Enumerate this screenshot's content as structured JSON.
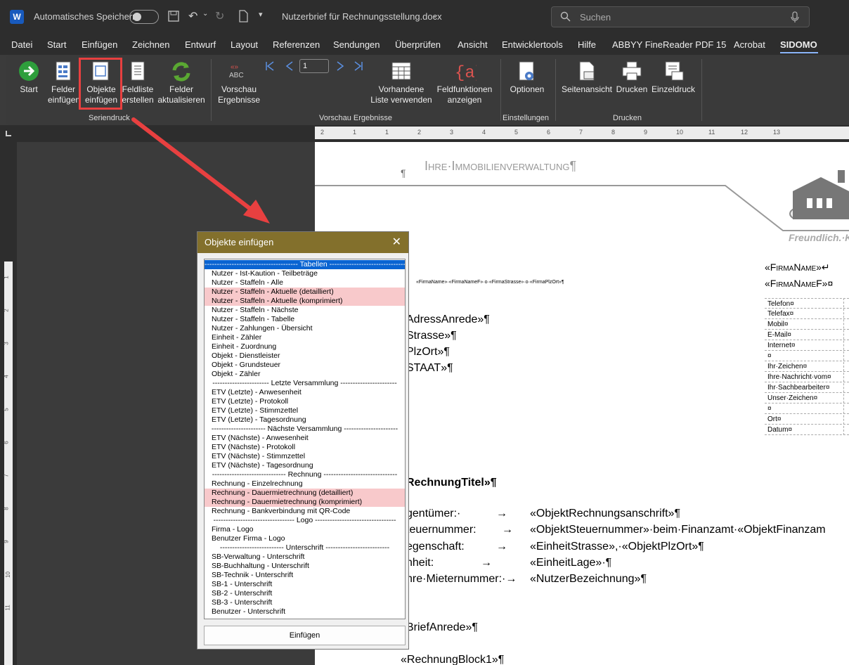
{
  "titlebar": {
    "app_logo": "W",
    "autosave_label": "Automatisches Speichern",
    "doc_title": "Nutzerbrief für Rechnungsstellung.docx",
    "search_placeholder": "Suchen"
  },
  "menu": [
    "Datei",
    "Start",
    "Einfügen",
    "Zeichnen",
    "Entwurf",
    "Layout",
    "Referenzen",
    "Sendungen",
    "Überprüfen",
    "Ansicht",
    "Entwicklertools",
    "Hilfe",
    "ABBYY FineReader PDF 15",
    "Acrobat",
    "SIDOMO"
  ],
  "ribbon": {
    "start": "Start",
    "felder_einfuegen_1": "Felder",
    "felder_einfuegen_2": "einfügen",
    "objekte_einfuegen_1": "Objekte",
    "objekte_einfuegen_2": "einfügen",
    "feldliste_1": "Feldliste",
    "feldliste_2": "erstellen",
    "felder_aktualisieren_1": "Felder",
    "felder_aktualisieren_2": "aktualisieren",
    "group_seriendruck": "Seriendruck",
    "vorschau_1": "Vorschau",
    "vorschau_2": "Ergebnisse",
    "record_number": "1",
    "vorhandene_1": "Vorhandene",
    "vorhandene_2": "Liste verwenden",
    "feldfunktionen_1": "Feldfunktionen",
    "feldfunktionen_2": "anzeigen",
    "group_vorschau": "Vorschau Ergebnisse",
    "optionen": "Optionen",
    "group_einstellungen": "Einstellungen",
    "seitenansicht": "Seitenansicht",
    "drucken": "Drucken",
    "einzeldruck": "Einzeldruck",
    "group_drucken": "Drucken"
  },
  "document": {
    "header_title": "Ihre·Immobilienverwaltung¶",
    "pilcrow": "¶",
    "slogan": "Freundlich.·K",
    "sender_line": "«FirmaName»·«FirmaNameF»·o·«FirmaStrasse»·o·«FirmaPlzOrt»¶",
    "firma_name": "«FirmaName»↵",
    "firma_name_f": "«FirmaNameF»¤",
    "address": [
      "AdressAnrede»¶",
      "Strasse»¶",
      "PlzOrt»¶",
      "STAAT»¶"
    ],
    "info_rows": [
      "Telefon¤",
      "Telefax¤",
      "Mobil¤",
      "E-Mail¤",
      "Internet¤",
      "¤",
      "Ihr·Zeichen¤",
      "Ihre·Nachricht·vom¤",
      "Ihr·Sachbearbeiter¤",
      "Unser·Zeichen¤",
      "¤",
      "Ort¤",
      "Datum¤"
    ],
    "rechnung_titel": "RechnungTitel»¶",
    "fields": [
      {
        "label": "gentümer:·",
        "arrow": "→",
        "value": "«ObjektRechnungsanschrift»¶"
      },
      {
        "label": "teuernummer:",
        "arrow": "→",
        "value": "«ObjektSteuernummer»·beim·Finanzamt·«ObjektFinanzam"
      },
      {
        "label": "egenschaft:",
        "arrow": "→",
        "value": "«EinheitStrasse»,·«ObjektPlzOrt»¶"
      },
      {
        "label": "nheit:",
        "arrow": "→",
        "value": "«EinheitLage»·¶"
      },
      {
        "label": "hre·Mieternummer:·→",
        "arrow": "",
        "value": "«NutzerBezeichnung»¶"
      }
    ],
    "brief_anrede": "BriefAnrede»¶",
    "rechnung_block": "«RechnungBlock1»¶"
  },
  "dialog": {
    "title": "Objekte einfügen",
    "close": "✕",
    "items": [
      {
        "text": "-------------------------------------- Tabellen --------------------------------------",
        "style": "sel"
      },
      {
        "text": "Nutzer - Ist-Kaution - Teilbeträge",
        "style": ""
      },
      {
        "text": "Nutzer - Staffeln - Alle",
        "style": ""
      },
      {
        "text": "Nutzer - Staffeln - Aktuelle (detailliert)",
        "style": "pink"
      },
      {
        "text": "Nutzer - Staffeln - Aktuelle (komprimiert)",
        "style": "pink"
      },
      {
        "text": "Nutzer - Staffeln - Nächste",
        "style": ""
      },
      {
        "text": "Nutzer - Staffeln - Tabelle",
        "style": ""
      },
      {
        "text": "Nutzer - Zahlungen - Übersicht",
        "style": ""
      },
      {
        "text": "Einheit - Zähler",
        "style": ""
      },
      {
        "text": "Einheit - Zuordnung",
        "style": ""
      },
      {
        "text": "Objekt - Dienstleister",
        "style": ""
      },
      {
        "text": "Objekt - Grundsteuer",
        "style": ""
      },
      {
        "text": "Objekt - Zähler",
        "style": ""
      },
      {
        "text": "----------------------- Letzte Versammlung -----------------------",
        "style": "hdr"
      },
      {
        "text": "ETV (Letzte) - Anwesenheit",
        "style": ""
      },
      {
        "text": "ETV (Letzte) - Protokoll",
        "style": ""
      },
      {
        "text": "ETV (Letzte) - Stimmzettel",
        "style": ""
      },
      {
        "text": "ETV (Letzte) - Tagesordnung",
        "style": ""
      },
      {
        "text": "---------------------- Nächste Versammlung ----------------------",
        "style": "hdr"
      },
      {
        "text": "ETV (Nächste) - Anwesenheit",
        "style": ""
      },
      {
        "text": "ETV (Nächste) - Protokoll",
        "style": ""
      },
      {
        "text": "ETV (Nächste) - Stimmzettel",
        "style": ""
      },
      {
        "text": "ETV (Nächste) - Tagesordnung",
        "style": ""
      },
      {
        "text": "------------------------------ Rechnung ------------------------------",
        "style": "hdr"
      },
      {
        "text": "Rechnung - Einzelrechnung",
        "style": ""
      },
      {
        "text": "Rechnung - Dauermietrechnung (detailliert)",
        "style": "pink"
      },
      {
        "text": "Rechnung - Dauermietrechnung (komprimiert)",
        "style": "pink"
      },
      {
        "text": "Rechnung - Bankverbindung mit QR-Code",
        "style": ""
      },
      {
        "text": "--------------------------------- Logo ---------------------------------",
        "style": "hdr"
      },
      {
        "text": "Firma - Logo",
        "style": ""
      },
      {
        "text": "Benutzer Firma - Logo",
        "style": ""
      },
      {
        "text": "-------------------------- Unterschrift --------------------------",
        "style": "hdr"
      },
      {
        "text": "SB-Verwaltung - Unterschrift",
        "style": ""
      },
      {
        "text": "SB-Buchhaltung - Unterschrift",
        "style": ""
      },
      {
        "text": "SB-Technik - Unterschrift",
        "style": ""
      },
      {
        "text": "SB-1 - Unterschrift",
        "style": ""
      },
      {
        "text": "SB-2 - Unterschrift",
        "style": ""
      },
      {
        "text": "SB-3 - Unterschrift",
        "style": ""
      },
      {
        "text": "Benutzer - Unterschrift",
        "style": ""
      }
    ],
    "insert_button": "Einfügen"
  },
  "ruler_numbers": [
    "2",
    "1",
    "1",
    "2",
    "3",
    "4",
    "5",
    "6",
    "7",
    "8",
    "9",
    "10",
    "11",
    "12",
    "13"
  ],
  "vruler_numbers": [
    "1",
    "2",
    "3",
    "4",
    "5",
    "6",
    "7",
    "8",
    "9",
    "10",
    "11"
  ],
  "colors": {
    "accent": "#e84040",
    "dialog_title": "#83702c",
    "pink": "#f8c9cb",
    "selection": "#0a64d2"
  }
}
